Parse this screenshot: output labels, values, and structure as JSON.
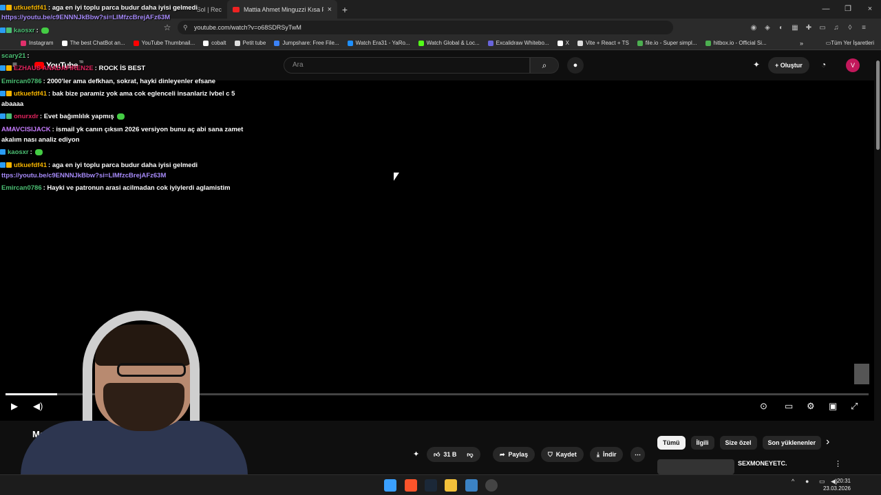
{
  "browser": {
    "tabs": [
      {
        "title": "Sol | Rec",
        "active": false
      },
      {
        "title": "Mattia Ahmet Minguzzi Kısa Film",
        "active": true
      }
    ],
    "new_tab": "+",
    "url": "youtube.com/watch?v=o68SDRSyTwM",
    "bookmarks": [
      {
        "label": "Instagram",
        "color": "#e1306c"
      },
      {
        "label": "The best ChatBot an...",
        "color": "#ffffff"
      },
      {
        "label": "YouTube Thumbnail...",
        "color": "#ff0000"
      },
      {
        "label": "cobalt",
        "color": "#ffffff"
      },
      {
        "label": "Petit tube",
        "color": "#dddddd"
      },
      {
        "label": "Jumpshare: Free File...",
        "color": "#3b82f6"
      },
      {
        "label": "Watch Era31 - YaRo...",
        "color": "#1e90ff"
      },
      {
        "label": "Watch Global & Loc...",
        "color": "#53fc18"
      },
      {
        "label": "Excalidraw Whitebo...",
        "color": "#6965db"
      },
      {
        "label": "X",
        "color": "#ffffff"
      },
      {
        "label": "Vite + React + TS",
        "color": "#dddddd"
      },
      {
        "label": "file.io - Super simpl...",
        "color": "#4caf50"
      },
      {
        "label": "hitbox.io - Official Si...",
        "color": "#4caf50"
      }
    ],
    "all_bookmarks": "Tüm Yer İşaretleri"
  },
  "youtube": {
    "logo_text": "YouTube",
    "region": "TR",
    "search_placeholder": "Ara",
    "create_label": "Oluştur",
    "avatar_letter": "V",
    "video_title_partial": "Ma",
    "likes": "31 B",
    "share_label": "Paylaş",
    "save_label": "Kaydet",
    "download_label": "İndir",
    "chips": [
      {
        "label": "Tümü",
        "active": true
      },
      {
        "label": "İlgili",
        "active": false
      },
      {
        "label": "Size özel",
        "active": false
      },
      {
        "label": "Son yüklenenler",
        "active": false
      }
    ],
    "recommended_title": "SEXMONEYETC.",
    "progress_fraction": 0.06
  },
  "chat": [
    {
      "user": "utkuefdf41",
      "color": "#f5b400",
      "text": ": aga en iyi toplu parca budur daha iyisi gelmedi",
      "badges": [
        "b1",
        "b2"
      ]
    },
    {
      "user": "",
      "color": "#a78bfa",
      "text": "https://youtu.be/c9ENNNJkBbw?si=LIMfzcBrejAFz63M",
      "link": true
    },
    {
      "user": "kaosxr",
      "color": "#4bbf73",
      "text": ":",
      "badges": [
        "b1",
        "b4"
      ],
      "emote": true
    },
    {
      "user": "scary21",
      "color": "#4bbf73",
      "text": ":",
      "badges": []
    },
    {
      "user": "EZHAUS ANADAFIREN2E",
      "color": "#e0245e",
      "text": ": ROCK İS BEST",
      "badges": [
        "b1",
        "b2"
      ]
    },
    {
      "user": "Emircan0786",
      "color": "#4bbf73",
      "text": ": 2000'ler ama defkhan, sokrat, hayki dinleyenler efsane",
      "badges": []
    },
    {
      "user": "utkuefdf41",
      "color": "#f5b400",
      "text": ": bak bize paramiz yok ama cok eglenceli insanlariz lvbel c 5",
      "badges": [
        "b1",
        "b2"
      ]
    },
    {
      "user": "",
      "color": "#ffffff",
      "text": "abaaaa"
    },
    {
      "user": "onurxdr",
      "color": "#e0245e",
      "text": ": Evet bağımlılık yapmış",
      "badges": [
        "b1",
        "b4"
      ],
      "emote": true
    },
    {
      "user": "AMAVCISIJACK",
      "color": "#c77dff",
      "text": ": ismail yk canın çıksın 2026 versiyon bunu aç abi sana zamet",
      "badges": []
    },
    {
      "user": "",
      "color": "#ffffff",
      "text": "akalım nası analiz ediyon"
    },
    {
      "user": "kaosxr",
      "color": "#4bbf73",
      "text": ":",
      "badges": [
        "b1"
      ],
      "emote": true
    },
    {
      "user": "utkuefdf41",
      "color": "#f5b400",
      "text": ": aga en iyi toplu parca budur daha iyisi gelmedi",
      "badges": [
        "b1",
        "b2"
      ]
    },
    {
      "user": "",
      "color": "#a78bfa",
      "text": "ttps://youtu.be/c9ENNNJkBbw?si=LIMfzcBrejAFz63M",
      "link": true
    },
    {
      "user": "Emircan0786",
      "color": "#4bbf73",
      "text": ": Hayki ve patronun arasi acilmadan cok iyiylerdi aglamistim",
      "badges": []
    }
  ],
  "taskbar": {
    "time": "20:31",
    "date": "23.03.2026"
  },
  "icons": {
    "close": "×",
    "minimize": "—",
    "restore": "❐",
    "search": "⌕",
    "mic": "🎤",
    "bell": "🔔",
    "play": "▶",
    "volume": "🔊",
    "settings": "⚙",
    "fullscreen": "⛶",
    "more": "⋯",
    "chevron_right": "›"
  }
}
